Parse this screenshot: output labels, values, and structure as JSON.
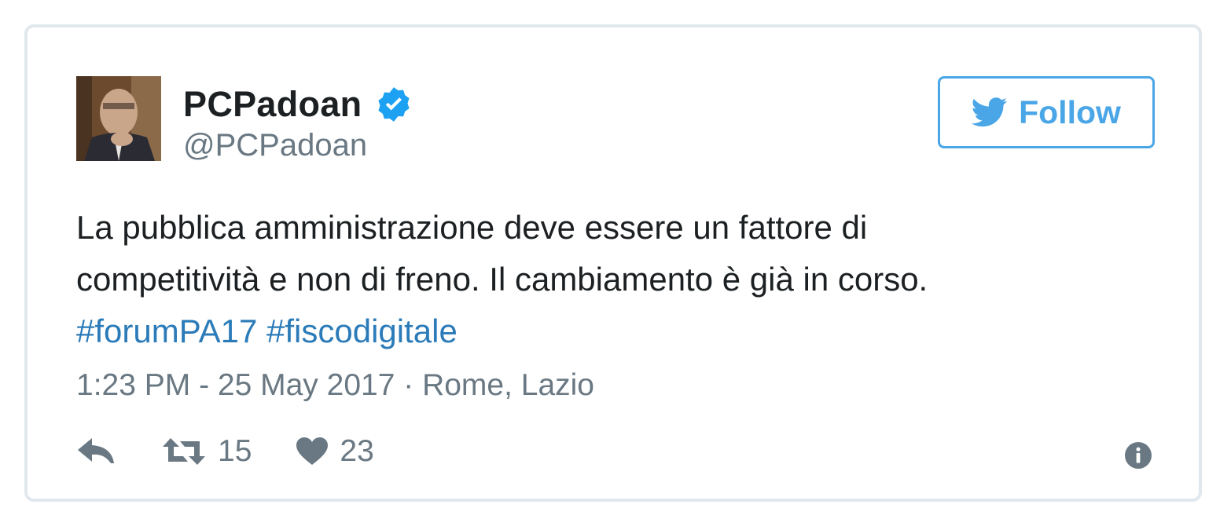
{
  "tweet": {
    "author": {
      "display_name": "PCPadoan",
      "handle": "@PCPadoan",
      "verified": true,
      "verified_icon": "verified-badge-icon",
      "avatar": "profile-photo"
    },
    "follow_button": {
      "label": "Follow",
      "icon": "twitter-bird-icon"
    },
    "text_lines": [
      "La pubblica amministrazione deve essere un fattore di",
      "competitività e non di freno. Il cambiamento è già in corso."
    ],
    "hashtags": [
      "#forumPA17",
      "#fiscodigitale"
    ],
    "timestamp": "1:23 PM - 25 May 2017",
    "separator": " · ",
    "location": "Rome, Lazio",
    "actions": {
      "reply_icon": "reply-icon",
      "retweet_icon": "retweet-icon",
      "retweet_count": "15",
      "like_icon": "heart-icon",
      "like_count": "23",
      "info_icon": "info-icon"
    }
  },
  "colors": {
    "accent": "#4aa6e6",
    "link": "#2b7bb9",
    "text": "#1c2022",
    "muted": "#697882",
    "border": "#e1e8ed",
    "verified": "#1da1f2"
  }
}
